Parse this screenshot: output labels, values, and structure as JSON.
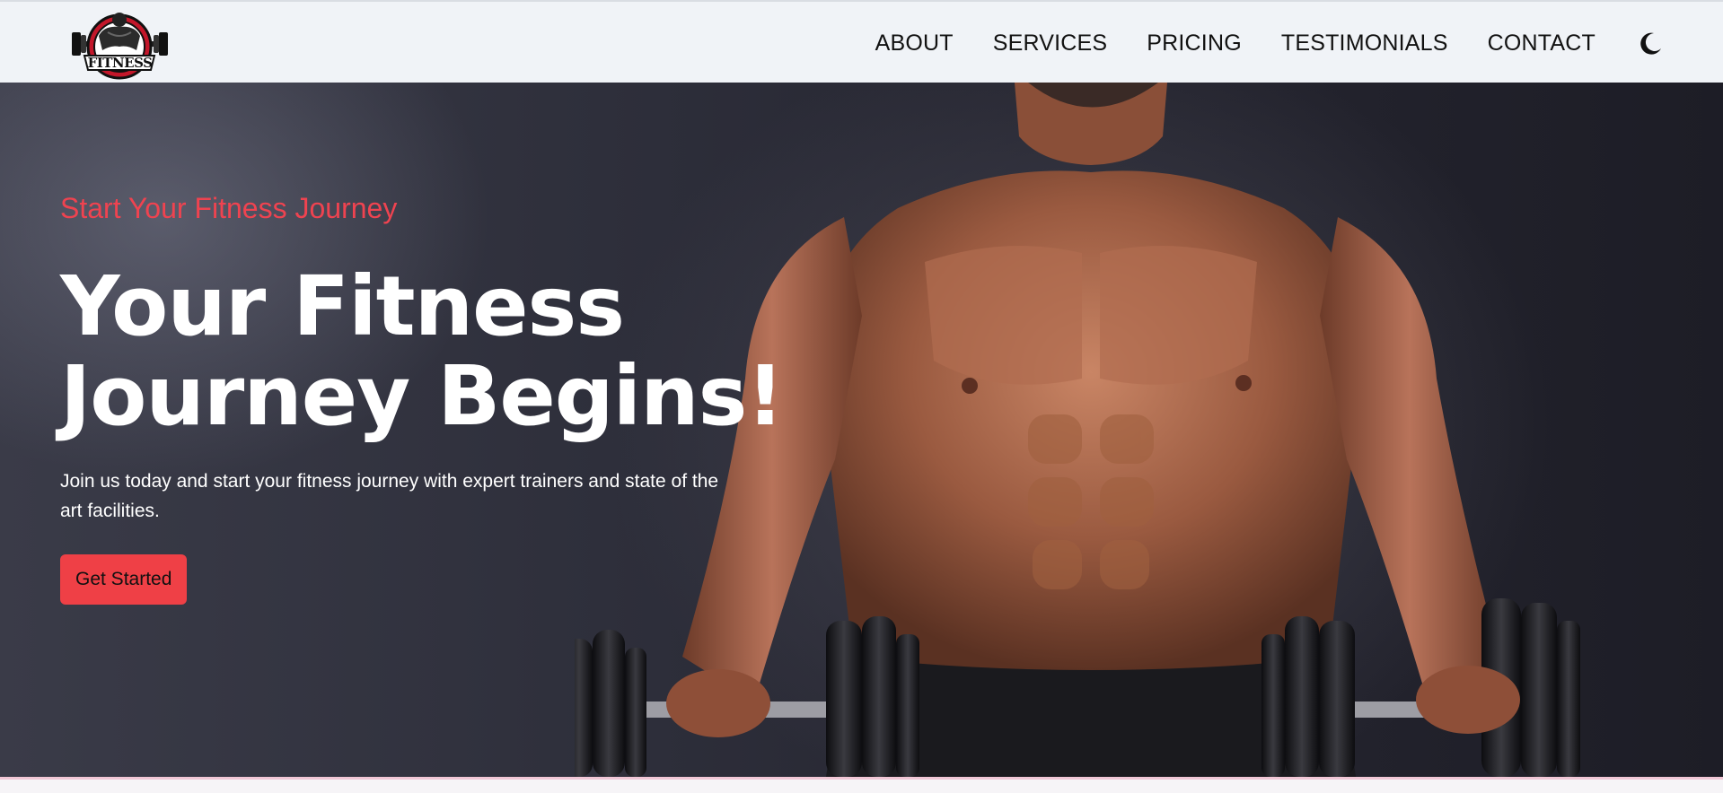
{
  "header": {
    "logo_text": "FITNESS",
    "nav": [
      {
        "label": "ABOUT"
      },
      {
        "label": "SERVICES"
      },
      {
        "label": "PRICING"
      },
      {
        "label": "TESTIMONIALS"
      },
      {
        "label": "CONTACT"
      }
    ],
    "theme_toggle_icon": "moon-icon"
  },
  "hero": {
    "eyebrow": "Start Your Fitness Journey",
    "headline_line1": "Your Fitness",
    "headline_line2": "Journey Begins!",
    "subtext": "Join us today and start your fitness journey with expert trainers and state of the art facilities.",
    "cta_label": "Get Started",
    "image": "bodybuilder-with-dumbbells"
  },
  "colors": {
    "accent": "#ef4046",
    "header_bg": "#f0f3f7",
    "hero_bg": "#2a2a35",
    "text_light": "#ffffff"
  }
}
